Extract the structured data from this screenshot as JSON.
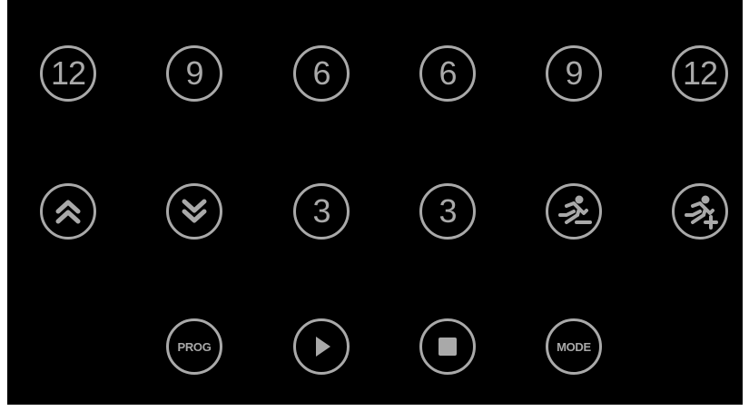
{
  "colors": {
    "background": "#000000",
    "foreground": "#a9a9a9"
  },
  "row1": {
    "b1": "12",
    "b2": "9",
    "b3": "6",
    "b4": "6",
    "b5": "9",
    "b6": "12"
  },
  "row2": {
    "b1_icon": "chevrons-up-icon",
    "b2_icon": "chevrons-down-icon",
    "b3": "3",
    "b4": "3",
    "b5_icon": "runner-minus-icon",
    "b6_icon": "runner-plus-icon"
  },
  "row3": {
    "prog": "PROG",
    "play_icon": "play-icon",
    "stop_icon": "stop-icon",
    "mode": "MODE"
  }
}
